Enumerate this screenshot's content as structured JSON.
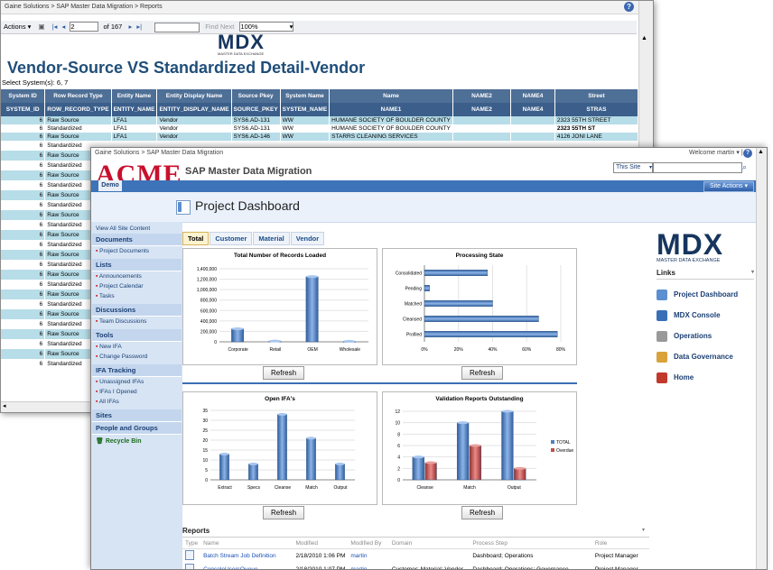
{
  "back": {
    "breadcrumb": "Gaine Solutions > SAP Master Data Migration > Reports",
    "toolbar": {
      "actions": "Actions ▾",
      "page_current": "2",
      "page_total": "of 167",
      "find_next": "Find Next",
      "zoom": "100%"
    },
    "logo_text": "MDX",
    "logo_sub": "MASTER DATA EXCHANGE",
    "title": "Vendor-Source VS Standardized Detail-Vendor",
    "systems": "Select System(s): 6, 7",
    "columns": [
      "System ID",
      "Row Record Type",
      "Entity Name",
      "Entity Display Name",
      "Source Pkey",
      "System Name",
      "Name",
      "NAME2",
      "NAME4",
      "Street"
    ],
    "subcolumns": [
      "SYSTEM_ID",
      "ROW_RECORD_TYPE",
      "ENTITY_NAME",
      "ENTITY_DISPLAY_NAME",
      "SOURCE_PKEY",
      "SYSTEM_NAME",
      "NAME1",
      "NAME2",
      "NAME4",
      "STRAS"
    ],
    "rows": [
      {
        "id": "6",
        "type": "Raw Source",
        "entity": "LFA1",
        "display": "Vendor",
        "pkey": "SYS6.AD-131",
        "sys": "WW",
        "name": "HUMANE SOCIETY OF BOULDER COUNTY",
        "street": "2323 55TH STREET",
        "bold": false
      },
      {
        "id": "6",
        "type": "Standardized",
        "entity": "LFA1",
        "display": "Vendor",
        "pkey": "SYS6.AD-131",
        "sys": "WW",
        "name": "HUMANE SOCIETY OF BOULDER COUNTY",
        "street": "2323 55TH ST",
        "bold": true
      },
      {
        "id": "6",
        "type": "Raw Source",
        "entity": "LFA1",
        "display": "Vendor",
        "pkey": "SYS6.AD-146",
        "sys": "WW",
        "name": "STARRS CLEANING SERVICES",
        "street": "4126 JONI LANE",
        "bold": false
      },
      {
        "id": "6",
        "type": "Standardized"
      },
      {
        "id": "6",
        "type": "Raw Source"
      },
      {
        "id": "6",
        "type": "Standardized"
      },
      {
        "id": "6",
        "type": "Raw Source"
      },
      {
        "id": "6",
        "type": "Standardized"
      },
      {
        "id": "6",
        "type": "Raw Source"
      },
      {
        "id": "6",
        "type": "Standardized"
      },
      {
        "id": "6",
        "type": "Raw Source"
      },
      {
        "id": "6",
        "type": "Standardized"
      },
      {
        "id": "6",
        "type": "Raw Source"
      },
      {
        "id": "6",
        "type": "Standardized"
      },
      {
        "id": "6",
        "type": "Raw Source"
      },
      {
        "id": "6",
        "type": "Standardized"
      },
      {
        "id": "6",
        "type": "Raw Source"
      },
      {
        "id": "6",
        "type": "Standardized"
      },
      {
        "id": "6",
        "type": "Raw Source"
      },
      {
        "id": "6",
        "type": "Standardized"
      },
      {
        "id": "6",
        "type": "Raw Source"
      },
      {
        "id": "6",
        "type": "Standardized"
      },
      {
        "id": "6",
        "type": "Raw Source"
      },
      {
        "id": "6",
        "type": "Standardized"
      },
      {
        "id": "6",
        "type": "Raw Source"
      },
      {
        "id": "6",
        "type": "Standardized"
      }
    ]
  },
  "front": {
    "breadcrumb": "Gaine Solutions > SAP Master Data Migration",
    "welcome": "Welcome martin ▾ |",
    "brand": "ACME",
    "site_title": "SAP Master Data Migration",
    "scope_select": "This Site",
    "demo_tab": "Demo",
    "site_actions": "Site Actions ▾",
    "page_title": "Project Dashboard",
    "nav": {
      "view_all": "View All Site Content",
      "sections": [
        {
          "title": "Documents",
          "items": [
            "Project Documents"
          ]
        },
        {
          "title": "Lists",
          "items": [
            "Announcements",
            "Project Calendar",
            "Tasks"
          ]
        },
        {
          "title": "Discussions",
          "items": [
            "Team Discussions"
          ]
        },
        {
          "title": "Tools",
          "items": [
            "New IFA",
            "Change Password"
          ]
        },
        {
          "title": "IFA Tracking",
          "items": [
            "Unassigned IFAs",
            "IFAs I Opened",
            "All IFAs"
          ]
        },
        {
          "title": "Sites",
          "items": []
        },
        {
          "title": "People and Groups",
          "items": []
        }
      ],
      "recycle": "Recycle Bin"
    },
    "tabs": [
      "Total",
      "Customer",
      "Material",
      "Vendor"
    ],
    "refresh_label": "Refresh",
    "right": {
      "logo_text": "MDX",
      "logo_sub": "MASTER DATA EXCHANGE",
      "links_title": "Links",
      "links": [
        "Project Dashboard",
        "MDX Console",
        "Operations",
        "Data Governance",
        "Home"
      ]
    },
    "reports": {
      "title": "Reports",
      "headers": [
        "Type",
        "Name",
        "Modified",
        "Modified By",
        "Domain",
        "Process Step",
        "Role"
      ],
      "rows": [
        {
          "name": "Batch Stream Job Definition",
          "modified": "2/18/2010 1:06 PM",
          "by": "martin",
          "domain": "",
          "step": "Dashboard; Operations",
          "role": "Project Manager"
        },
        {
          "name": "ConsoleUsersQueue",
          "modified": "2/18/2010 1:07 PM",
          "by": "martin",
          "domain": "Customer; Material; Vendor",
          "step": "Dashboard; Operations; Governance",
          "role": "Project Manager"
        }
      ]
    }
  },
  "chart_data": [
    {
      "type": "bar",
      "title": "Total Number of Records Loaded",
      "categories": [
        "Corporate",
        "Retail",
        "OEM",
        "Wholesale"
      ],
      "values": [
        250000,
        15000,
        1250000,
        10000
      ],
      "ylim": [
        0,
        1400000
      ],
      "yticks": [
        "1,400,000",
        "1,200,000",
        "1,000,000",
        "800,000",
        "600,000",
        "400,000",
        "200,000",
        "0"
      ],
      "color": "#4f81bd"
    },
    {
      "type": "bar",
      "orientation": "horizontal",
      "title": "Processing State",
      "categories": [
        "Consolidated",
        "Pending",
        "Matched",
        "Cleansed",
        "Profiled"
      ],
      "values": [
        37,
        3,
        40,
        67,
        78
      ],
      "xlim": [
        0,
        80
      ],
      "xticks": [
        "0%",
        "20%",
        "40%",
        "60%",
        "80%"
      ],
      "color": "#4f81bd"
    },
    {
      "type": "bar",
      "title": "Open IFA's",
      "categories": [
        "Extract",
        "Specs",
        "Cleanse",
        "Match",
        "Output"
      ],
      "values": [
        13,
        8,
        33,
        21,
        8
      ],
      "ylim": [
        0,
        35
      ],
      "yticks": [
        "35",
        "30",
        "25",
        "20",
        "15",
        "10",
        "5",
        "0"
      ],
      "color": "#4f81bd"
    },
    {
      "type": "bar",
      "title": "Validation Reports Outstanding",
      "categories": [
        "Cleanse",
        "Match",
        "Output"
      ],
      "series": [
        {
          "name": "TOTAL",
          "values": [
            4,
            10,
            12
          ],
          "color": "#4f81bd"
        },
        {
          "name": "Overdue",
          "values": [
            3,
            6,
            2
          ],
          "color": "#c0504d"
        }
      ],
      "ylim": [
        0,
        12
      ],
      "yticks": [
        "12",
        "10",
        "8",
        "6",
        "4",
        "2",
        "0"
      ]
    }
  ]
}
